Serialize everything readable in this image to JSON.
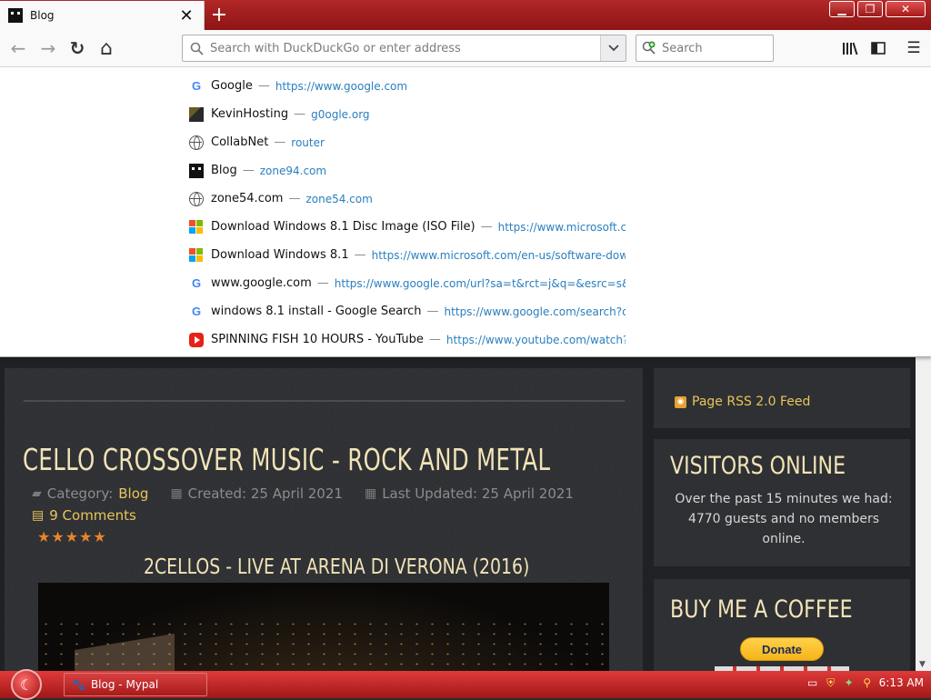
{
  "window": {
    "tab_title": "Blog",
    "tab_close": "✕",
    "new_tab": "+",
    "win_minimize": "▁",
    "win_restore": "❐",
    "win_close": "✕"
  },
  "nav": {
    "back": "←",
    "forward": "→",
    "reload": "↻",
    "home": "⌂",
    "url_placeholder": "Search with DuckDuckGo or enter address",
    "url_dropdown": "▾",
    "search_placeholder": "Search",
    "library": "|||\\",
    "sidebar": "◫",
    "menu": "☰"
  },
  "suggestions": [
    {
      "icon": "google-icon",
      "title": "Google",
      "url": "https://www.google.com"
    },
    {
      "icon": "kevinhosting-icon",
      "title": "KevinHosting",
      "url": "g0ogle.org"
    },
    {
      "icon": "globe-icon",
      "title": "CollabNet",
      "url": "router"
    },
    {
      "icon": "blog-icon",
      "title": "Blog",
      "url": "zone94.com"
    },
    {
      "icon": "globe-icon",
      "title": "zone54.com",
      "url": "zone54.com"
    },
    {
      "icon": "windows-icon",
      "title": "Download Windows 8.1 Disc Image (ISO File)",
      "url": "https://www.microsoft.com"
    },
    {
      "icon": "windows-icon",
      "title": "Download Windows 8.1",
      "url": "https://www.microsoft.com/en-us/software-downlo"
    },
    {
      "icon": "google-icon",
      "title": "www.google.com",
      "url": "https://www.google.com/url?sa=t&rct=j&q=&esrc=s&sour"
    },
    {
      "icon": "google-icon",
      "title": "windows 8.1 install - Google Search",
      "url": "https://www.google.com/search?q=wi"
    },
    {
      "icon": "youtube-icon",
      "title": "SPINNING FISH 10 HOURS - YouTube",
      "url": "https://www.youtube.com/watch?v"
    }
  ],
  "dash": "—",
  "article": {
    "title": "CELLO CROSSOVER MUSIC - ROCK AND METAL",
    "category_label": "Category:",
    "category": "Blog",
    "created": "Created: 25 April 2021",
    "updated": "Last Updated: 25 April 2021",
    "comments": "9 Comments",
    "rating": 5,
    "stars": "★★★★★",
    "subtitle": "2CELLOS - LIVE AT ARENA DI VERONA (2016)"
  },
  "sidebar": {
    "rss": "Page RSS 2.0 Feed",
    "visitors_title": "VISITORS ONLINE",
    "visitors_text": "Over the past 15 minutes we had: 4770 guests and no members online.",
    "coffee_title": "BUY ME A COFFEE",
    "donate": "Donate"
  },
  "taskbar": {
    "task_label": "Blog - Mypal",
    "time": "6:13 AM"
  },
  "colors": {
    "accent_gold": "#e8c55a",
    "heading": "#f2e4b8",
    "chrome_red": "#a11717",
    "link_blue": "#2a7fbf"
  }
}
